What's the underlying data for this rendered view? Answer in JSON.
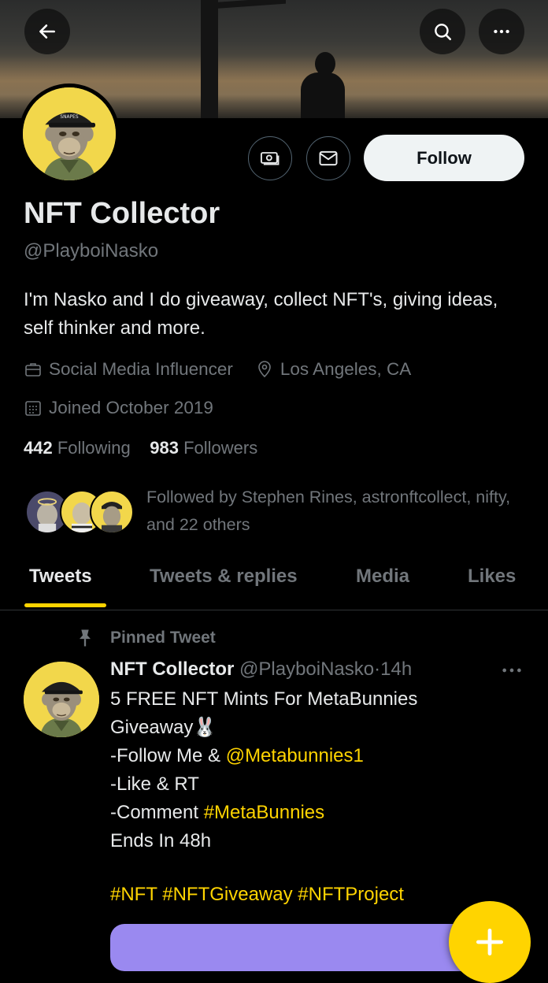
{
  "profile": {
    "name": "NFT Collector",
    "handle": "@PlayboiNasko",
    "bio": "I'm Nasko and I do giveaway, collect NFT's, giving ideas, self thinker and more.",
    "category": "Social Media Influencer",
    "location": "Los Angeles, CA",
    "joined": "Joined October 2019",
    "following_count": "442",
    "following_label": "Following",
    "followers_count": "983",
    "followers_label": "Followers",
    "followed_by": "Followed by Stephen Rines, astronftcollect, nifty, and 22 others",
    "follow_label": "Follow"
  },
  "icons": {
    "back": "arrow-left-icon",
    "search": "search-icon",
    "more": "more-icon",
    "tip": "money-icon",
    "message": "mail-icon",
    "category": "briefcase-icon",
    "location": "location-pin-icon",
    "joined": "calendar-icon",
    "pin": "pin-icon",
    "compose": "plus-icon"
  },
  "tabs": [
    {
      "label": "Tweets",
      "active": true
    },
    {
      "label": "Tweets & replies",
      "active": false
    },
    {
      "label": "Media",
      "active": false
    },
    {
      "label": "Likes",
      "active": false
    }
  ],
  "pinned_tweet": {
    "pinned_label": "Pinned Tweet",
    "author_name": "NFT Collector",
    "author_handle": "@PlayboiNasko",
    "time": "14h",
    "line1": "5 FREE NFT Mints For MetaBunnies",
    "line2": "Giveaway",
    "emoji": "🐰",
    "line3_prefix": "-Follow Me & ",
    "line3_mention": "@Metabunnies1",
    "line4": "-Like & RT",
    "line5_prefix": "-Comment ",
    "line5_hashtag": "#MetaBunnies",
    "line6": "Ends In 48h",
    "tags": "#NFT #NFTGiveaway #NFTProject"
  },
  "colors": {
    "accent": "#ffd400",
    "background": "#000000",
    "text": "#e7e9ea",
    "secondary_text": "#71767b",
    "border": "#2f3336"
  }
}
